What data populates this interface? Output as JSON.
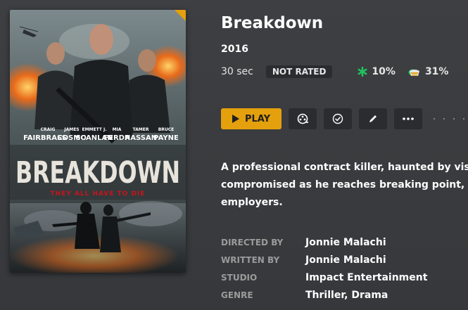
{
  "poster": {
    "title_text": "BREAKDOWN",
    "tagline": "THEY ALL HAVE TO DIE",
    "cast_names": [
      [
        "CRAIG",
        "FAIRBRASS"
      ],
      [
        "JAMES",
        "COSMO"
      ],
      [
        "EMMETT J.",
        "SCANLAN"
      ],
      [
        "MIA",
        "FERDA"
      ],
      [
        "TAMER",
        "HASSAN"
      ],
      [
        "BRUCE",
        "PAYNE"
      ]
    ]
  },
  "movie": {
    "title": "Breakdown",
    "year": "2016",
    "duration": "30 sec",
    "content_rating": "NOT RATED",
    "critic_score": "10%",
    "audience_score": "31%",
    "summary_lines": [
      "A professional contract killer, haunted by visions",
      "compromised as he reaches breaking point, he is",
      "employers."
    ]
  },
  "actions": {
    "play_label": "PLAY"
  },
  "credits": [
    {
      "label": "DIRECTED BY",
      "value": "Jonnie Malachi"
    },
    {
      "label": "WRITTEN BY",
      "value": "Jonnie Malachi"
    },
    {
      "label": "STUDIO",
      "value": "Impact Entertainment"
    },
    {
      "label": "GENRE",
      "value": "Thriller, Drama"
    }
  ],
  "colors": {
    "accent": "#e5a00d",
    "background": "#3a3c3f",
    "button_bg": "#2a2c2f",
    "critic_icon": "#21c061",
    "tagline_red": "#c8141b"
  },
  "icons": {
    "critic": "splat-icon",
    "audience": "popcorn-icon",
    "trailer": "film-reel-icon",
    "watched": "check-circle-icon",
    "edit": "pencil-icon",
    "more": "ellipsis-icon"
  }
}
